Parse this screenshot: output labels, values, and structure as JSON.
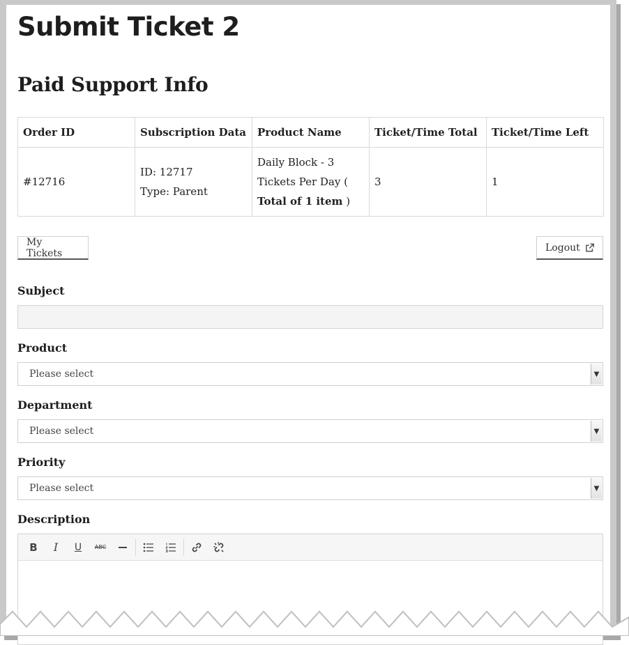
{
  "page": {
    "title": "Submit Ticket 2"
  },
  "support_info": {
    "title": "Paid Support Info",
    "columns": [
      "Order ID",
      "Subscription Data",
      "Product Name",
      "Ticket/Time Total",
      "Ticket/Time Left"
    ],
    "row": {
      "order_id": "#12716",
      "subscription_id": "ID: 12717",
      "subscription_type": "Type: Parent",
      "product_name": "Daily Block - 3 Tickets Per Day (",
      "product_bold": "Total of 1 item",
      "product_close": ")",
      "total": "3",
      "left": "1"
    }
  },
  "nav": {
    "my_tickets": "My Tickets",
    "logout": "Logout",
    "logout_icon": "external-link-icon"
  },
  "form": {
    "subject_label": "Subject",
    "subject_value": "",
    "product_label": "Product",
    "product_value": "Please select",
    "department_label": "Department",
    "department_value": "Please select",
    "priority_label": "Priority",
    "priority_value": "Please select",
    "description_label": "Description"
  },
  "editor_toolbar": [
    "bold-icon",
    "italic-icon",
    "underline-icon",
    "strikethrough-icon",
    "horizontal-rule-icon",
    "bullet-list-icon",
    "numbered-list-icon",
    "link-icon",
    "unlink-icon"
  ],
  "colors": {
    "frame": "#c9c9c9",
    "field_bg": "#f4f4f4",
    "border": "#d4d4d4"
  }
}
